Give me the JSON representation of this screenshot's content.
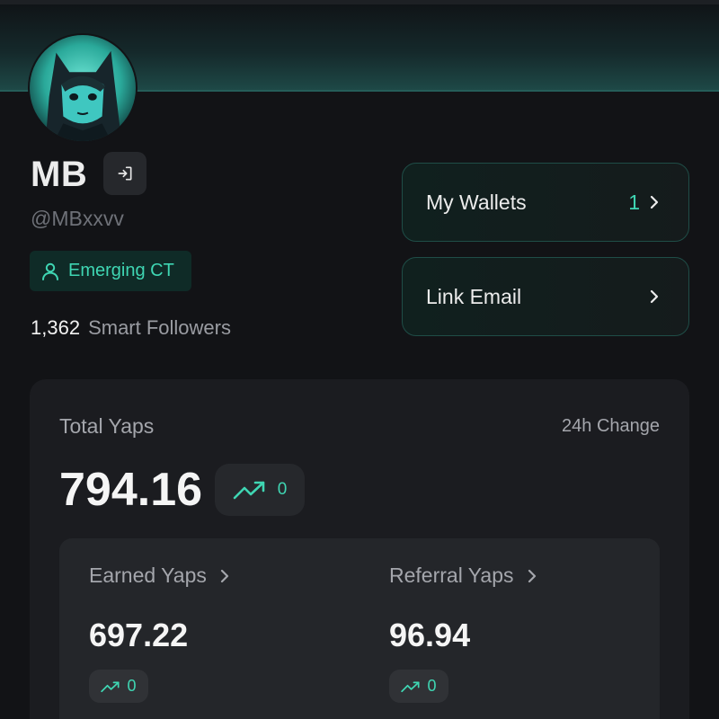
{
  "profile": {
    "name": "MB",
    "handle": "@MBxxvv",
    "tier": "Emerging CT",
    "followers_count": "1,362",
    "followers_label": "Smart Followers"
  },
  "actions": {
    "wallets_label": "My Wallets",
    "wallets_count": "1",
    "email_label": "Link Email"
  },
  "yaps": {
    "total_label": "Total Yaps",
    "change_label": "24h Change",
    "total_value": "794.16",
    "total_change": "0",
    "earned": {
      "label": "Earned Yaps",
      "value": "697.22",
      "change": "0"
    },
    "referral": {
      "label": "Referral Yaps",
      "value": "96.94",
      "change": "0"
    }
  },
  "icons": {
    "logout": "logout-icon",
    "tier": "user-icon",
    "chevron": "chevron-right-icon",
    "trend": "trending-up-icon"
  },
  "colors": {
    "accent": "#3fd6b3",
    "background": "#121316",
    "card": "#1b1c20",
    "inner_card": "#24262a"
  }
}
